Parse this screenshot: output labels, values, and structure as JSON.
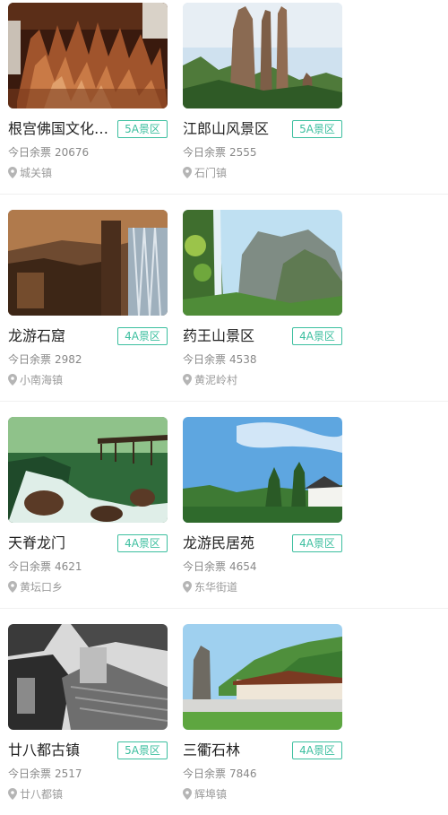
{
  "tickets_label": "今日余票",
  "colors": {
    "accent": "#3cbf9f",
    "title": "#222222",
    "meta": "#888888"
  },
  "attractions": [
    {
      "name": "根宫佛国文化旅游区",
      "grade": "5A景区",
      "tickets": "20676",
      "town": "城关镇",
      "image": "wood-carving-hall"
    },
    {
      "name": "江郎山风景区",
      "grade": "5A景区",
      "tickets": "2555",
      "town": "石门镇",
      "image": "rock-peaks"
    },
    {
      "name": "龙游石窟",
      "grade": "4A景区",
      "tickets": "2982",
      "town": "小南海镇",
      "image": "stone-grotto"
    },
    {
      "name": "药王山景区",
      "grade": "4A景区",
      "tickets": "4538",
      "town": "黄泥岭村",
      "image": "mountain-waterfall"
    },
    {
      "name": "天脊龙门",
      "grade": "4A景区",
      "tickets": "4621",
      "town": "黄坛口乡",
      "image": "forest-stream"
    },
    {
      "name": "龙游民居苑",
      "grade": "4A景区",
      "tickets": "4654",
      "town": "东华街道",
      "image": "village-sky"
    },
    {
      "name": "廿八都古镇",
      "grade": "5A景区",
      "tickets": "2517",
      "town": "廿八都镇",
      "image": "old-town-rooftops"
    },
    {
      "name": "三衢石林",
      "grade": "4A景区",
      "tickets": "7846",
      "town": "辉埠镇",
      "image": "stone-forest-gate"
    }
  ]
}
